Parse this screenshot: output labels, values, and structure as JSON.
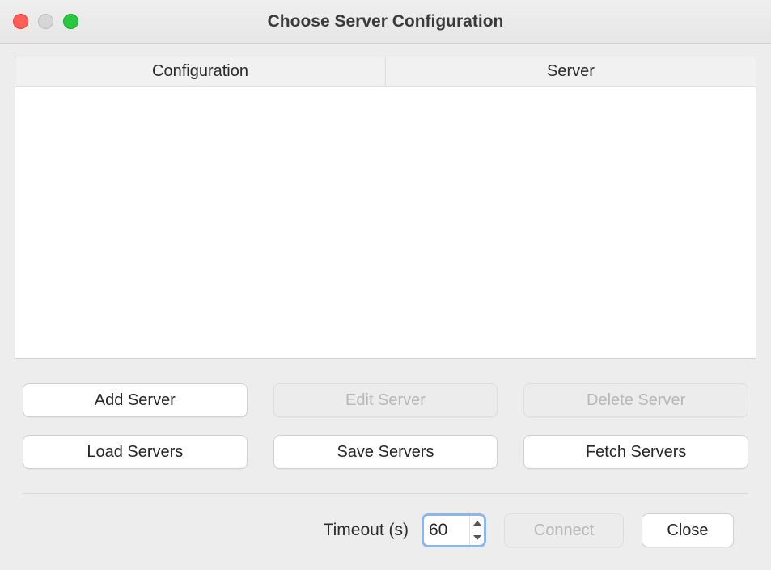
{
  "window": {
    "title": "Choose Server Configuration"
  },
  "table": {
    "columns": [
      "Configuration",
      "Server"
    ],
    "rows": []
  },
  "buttons": {
    "add_server": "Add Server",
    "edit_server": "Edit Server",
    "delete_server": "Delete Server",
    "load_servers": "Load Servers",
    "save_servers": "Save Servers",
    "fetch_servers": "Fetch Servers",
    "connect": "Connect",
    "close": "Close"
  },
  "footer": {
    "timeout_label": "Timeout (s)",
    "timeout_value": "60"
  },
  "colors": {
    "window_bg": "#ededed",
    "focus_ring": "#8db6f0"
  }
}
